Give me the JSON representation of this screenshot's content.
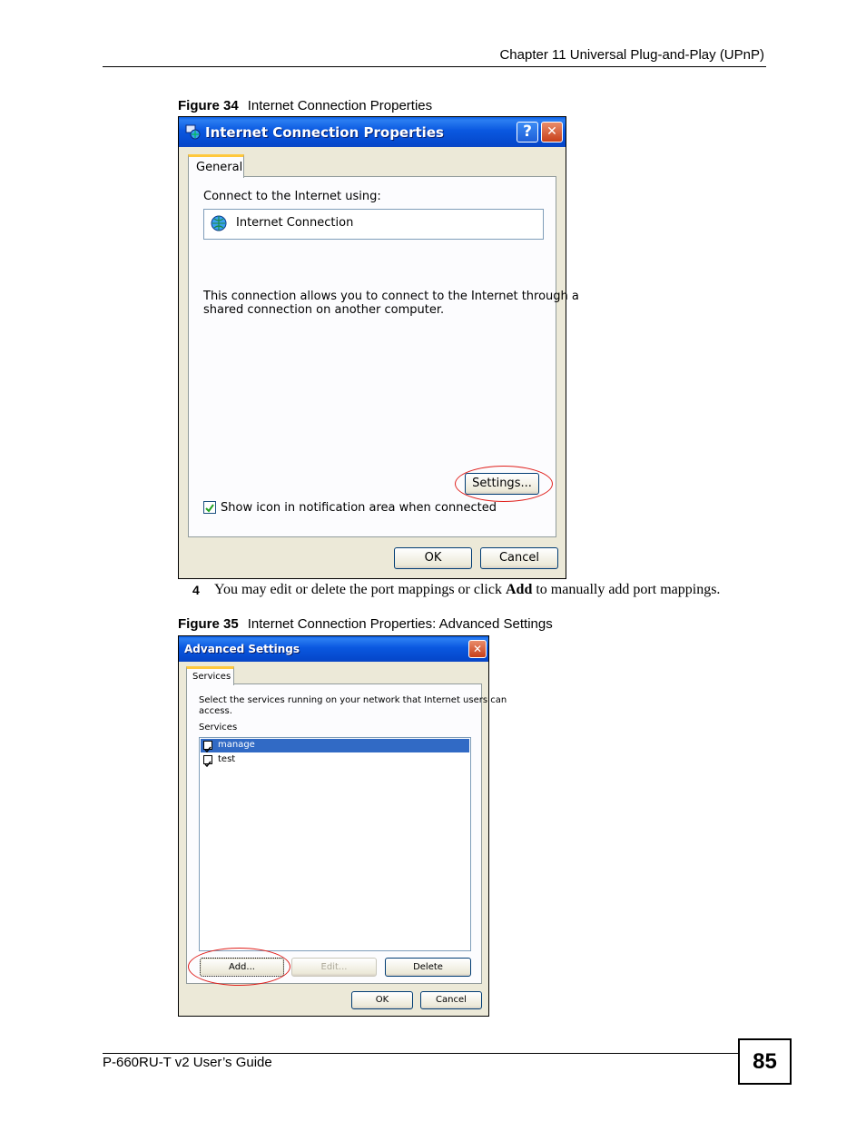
{
  "header": {
    "chapter": "Chapter 11 Universal Plug-and-Play (UPnP)"
  },
  "figure34": {
    "label": "Figure 34",
    "caption": "Internet Connection Properties",
    "window": {
      "title": "Internet Connection Properties",
      "help_glyph": "?",
      "close_glyph": "✕",
      "tab": "General",
      "connect_label": "Connect to the Internet using:",
      "connection_name": "Internet Connection",
      "description_line1": "This connection allows you to connect to the Internet through a",
      "description_line2": "shared connection on another computer.",
      "settings_button": "Settings...",
      "show_icon_label": "Show icon in notification area when connected",
      "show_icon_checked": true,
      "ok_button": "OK",
      "cancel_button": "Cancel"
    }
  },
  "step": {
    "number": "4",
    "text_before": "You may edit or delete the port mappings or click ",
    "text_bold": "Add",
    "text_after": " to manually add port mappings."
  },
  "figure35": {
    "label": "Figure 35",
    "caption": "Internet Connection Properties: Advanced Settings",
    "window": {
      "title": "Advanced Settings",
      "close_glyph": "✕",
      "tab": "Services",
      "instruction_line1": "Select the services running on your network that Internet users can",
      "instruction_line2": "access.",
      "services_label": "Services",
      "services": [
        {
          "name": "manage",
          "checked": true,
          "selected": true
        },
        {
          "name": "test",
          "checked": true,
          "selected": false
        }
      ],
      "add_button": "Add...",
      "edit_button": "Edit...",
      "delete_button": "Delete",
      "ok_button": "OK",
      "cancel_button": "Cancel"
    }
  },
  "footer": {
    "guide": "P-660RU-T v2 User’s Guide",
    "page_number": "85"
  },
  "colors": {
    "annotation_ellipse": "#e0201c",
    "title_bar": "#0548cc",
    "selection": "#316ac5"
  }
}
